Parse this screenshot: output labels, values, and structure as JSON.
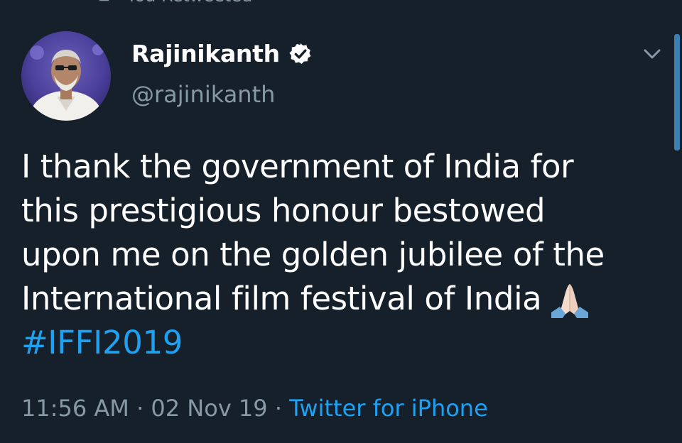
{
  "retweet_context": {
    "label": "You Retweeted",
    "icon": "retweet-icon"
  },
  "tweet": {
    "author": {
      "display_name": "Rajinikanth",
      "handle": "@rajinikanth",
      "verified": true,
      "verified_icon": "verified-badge-icon"
    },
    "text_lines": [
      "I thank the government of India for",
      "this prestigious honour bestowed",
      "upon me on the golden jubilee of the",
      "International film festival of India"
    ],
    "emoji": "folded-hands-icon",
    "hashtag": "#IFFI2019",
    "time": "11:56 AM",
    "separator_1": " · ",
    "date": "02 Nov 19",
    "separator_2": " · ",
    "source": "Twitter for iPhone"
  },
  "menu": {
    "icon": "chevron-down-icon"
  },
  "colors": {
    "background": "#15202b",
    "primary_text": "#ffffff",
    "secondary_text": "#8899a6",
    "link": "#1da1f2",
    "scrollbar": "#3e7fb3"
  }
}
